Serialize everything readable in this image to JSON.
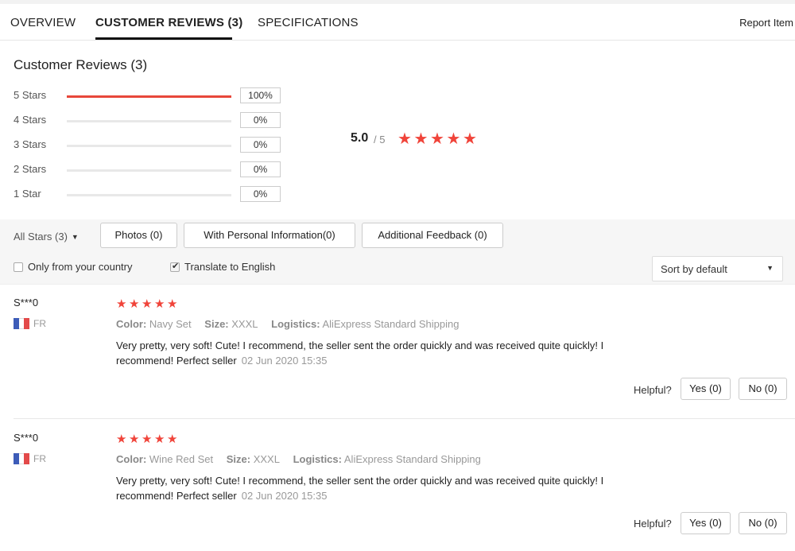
{
  "tabs": [
    {
      "label": "OVERVIEW"
    },
    {
      "label": "CUSTOMER REVIEWS (3)"
    },
    {
      "label": "SPECIFICATIONS"
    }
  ],
  "report_label": "Report Item",
  "section_title": "Customer Reviews (3)",
  "distribution": [
    {
      "label": "5 Stars",
      "percent_text": "100%",
      "fraction": 1.0
    },
    {
      "label": "4 Stars",
      "percent_text": "0%",
      "fraction": 0
    },
    {
      "label": "3 Stars",
      "percent_text": "0%",
      "fraction": 0
    },
    {
      "label": "2 Stars",
      "percent_text": "0%",
      "fraction": 0
    },
    {
      "label": "1 Star",
      "percent_text": "0%",
      "fraction": 0
    }
  ],
  "overall": {
    "score": "5.0",
    "out_of": "/ 5",
    "stars": 5
  },
  "filters": {
    "all_stars": "All Stars (3)",
    "photos": "Photos (0)",
    "personal": "With Personal Information(0)",
    "additional": "Additional Feedback (0)",
    "only_country": "Only from your country",
    "only_country_checked": false,
    "translate": "Translate to English",
    "translate_checked": true,
    "sort": "Sort by default"
  },
  "reviews": [
    {
      "user": "S***0",
      "country": "FR",
      "stars": 5,
      "color_key": "Color:",
      "color": "Navy Set",
      "size_key": "Size:",
      "size": "XXXL",
      "logistics_key": "Logistics:",
      "logistics": "AliExpress Standard Shipping",
      "text": "Very pretty, very soft! Cute! I recommend, the seller sent the order quickly and was received quite quickly! I recommend! Perfect seller",
      "date": "02 Jun 2020 15:35",
      "helpful_label": "Helpful?",
      "yes": "Yes (0)",
      "no": "No (0)"
    },
    {
      "user": "S***0",
      "country": "FR",
      "stars": 5,
      "color_key": "Color:",
      "color": "Wine Red Set",
      "size_key": "Size:",
      "size": "XXXL",
      "logistics_key": "Logistics:",
      "logistics": "AliExpress Standard Shipping",
      "text": "Very pretty, very soft! Cute! I recommend, the seller sent the order quickly and was received quite quickly! I recommend! Perfect seller",
      "date": "02 Jun 2020 15:35",
      "helpful_label": "Helpful?",
      "yes": "Yes (0)",
      "no": "No (0)"
    }
  ],
  "colors": {
    "accent_red": "#e8473a",
    "star_red": "#f0443a",
    "flag_blue": "#3d5cb8",
    "flag_red": "#e34a4a"
  },
  "icons": {
    "star": "star-icon",
    "chevron": "chevron-down-icon",
    "check": "checkbox-check-icon",
    "flag": "france-flag-icon"
  }
}
